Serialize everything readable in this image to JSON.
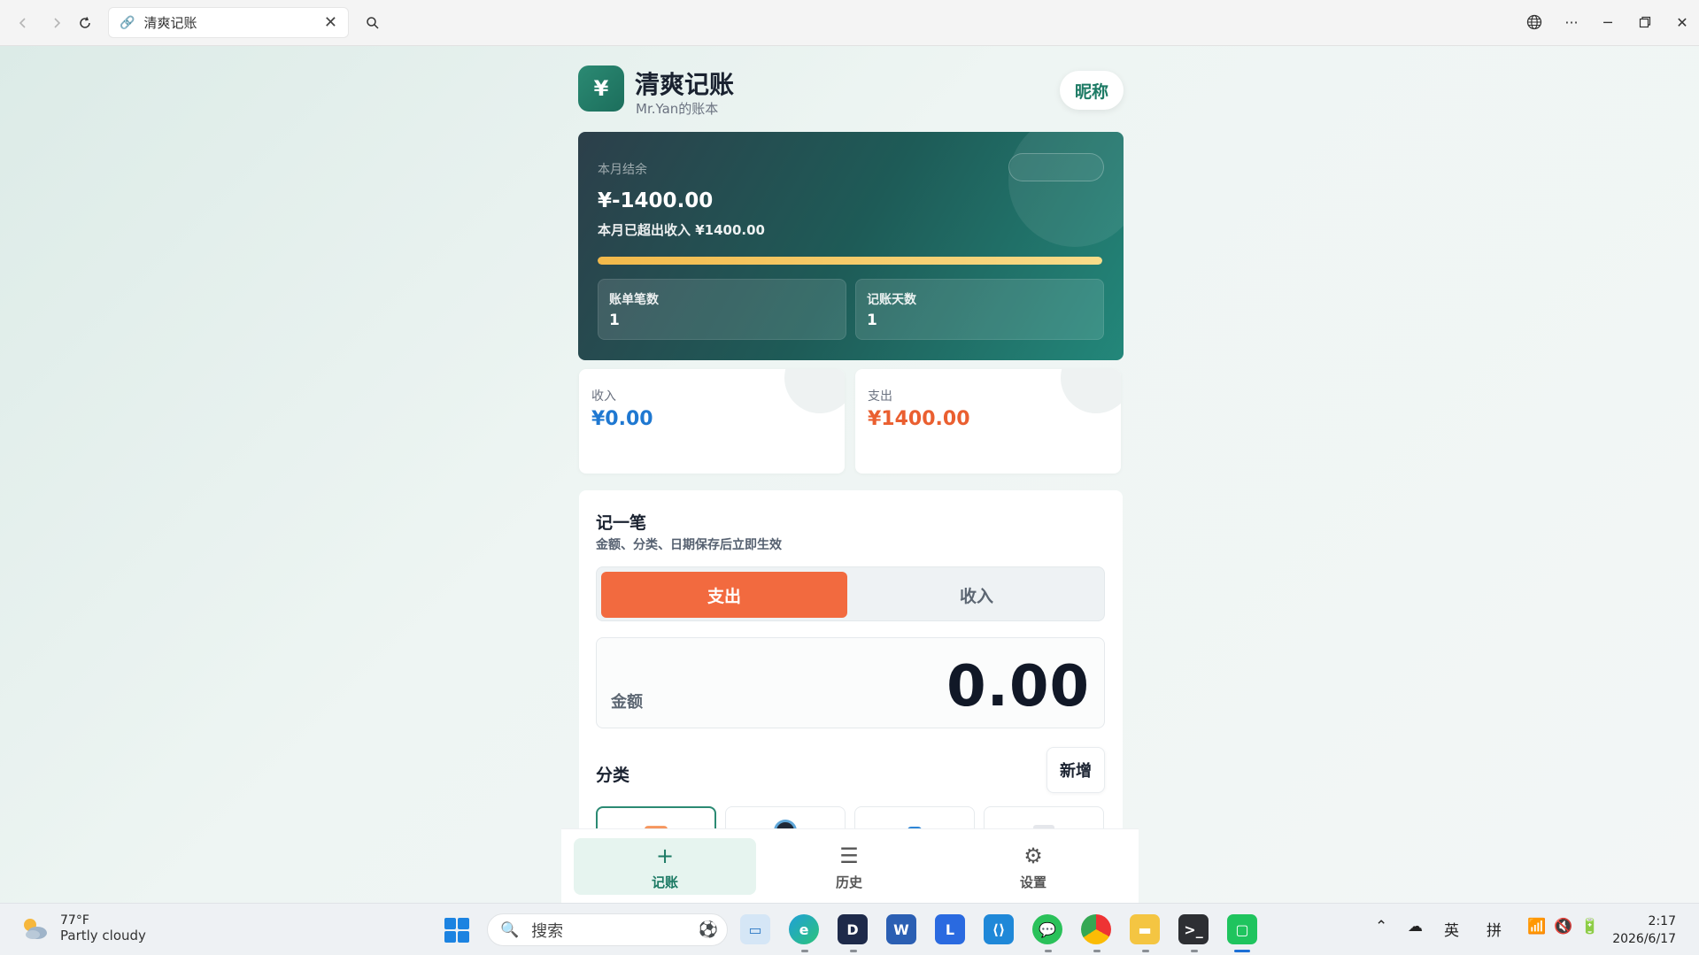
{
  "browser": {
    "tab_title": "清爽记账",
    "back_icon": "chevron-left-icon",
    "forward_icon": "chevron-right-icon",
    "refresh_icon": "refresh-icon",
    "search_icon": "search-icon"
  },
  "header": {
    "logo_text": "¥",
    "title": "清爽记账",
    "subtitle": "Mr.Yan的账本",
    "nickname_button": "昵称"
  },
  "balance": {
    "label": "本月结余",
    "amount": "¥-1400.00",
    "note": "本月已超出收入 ¥1400.00",
    "progress": 1.0,
    "stats": [
      {
        "label": "账单笔数",
        "value": "1"
      },
      {
        "label": "记账天数",
        "value": "1"
      }
    ]
  },
  "summary": {
    "income": {
      "label": "收入",
      "value": "¥0.00",
      "color": "#1f78d1"
    },
    "expense": {
      "label": "支出",
      "value": "¥1400.00",
      "color": "#ea5f30"
    }
  },
  "form": {
    "title": "记一笔",
    "subtitle": "金额、分类、日期保存后立即生效",
    "segment": {
      "expense": "支出",
      "income": "收入"
    },
    "amount_label": "金额",
    "amount_value": "0.00",
    "category_title": "分类",
    "add_button": "新增"
  },
  "bottom_nav": [
    {
      "icon": "+",
      "label": "记账"
    },
    {
      "icon": "☰",
      "label": "历史"
    },
    {
      "icon": "⚙",
      "label": "设置"
    }
  ],
  "taskbar": {
    "temperature": "77°F",
    "weather": "Partly cloudy",
    "search_placeholder": "搜索",
    "ime_1": "英",
    "ime_2": "拼",
    "time": "2:17",
    "date": "2026/6/17"
  },
  "colors": {
    "accent": "#1c7a64",
    "expense": "#f26a3f",
    "income": "#1f78d1"
  }
}
